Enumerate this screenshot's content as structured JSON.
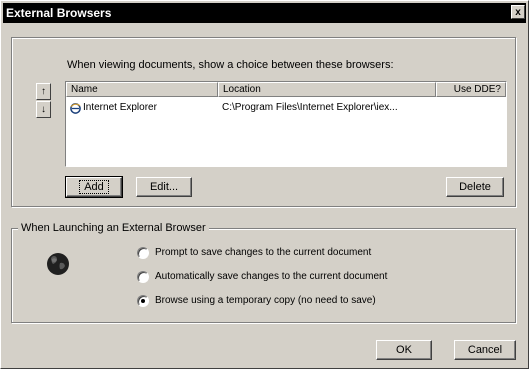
{
  "window": {
    "title": "External Browsers",
    "close_glyph": "x"
  },
  "browsers_group": {
    "instruction": "When viewing documents, show a choice between these browsers:",
    "move_up_glyph": "↑",
    "move_down_glyph": "↓",
    "columns": [
      "Name",
      "Location",
      "Use DDE?"
    ],
    "rows": [
      {
        "name": "Internet Explorer",
        "location": "C:\\Program Files\\Internet Explorer\\iex...",
        "use_dde": "",
        "icon": "internet-explorer-icon"
      }
    ],
    "add_label": "Add",
    "edit_label": "Edit...",
    "delete_label": "Delete"
  },
  "launch_group": {
    "legend": "When Launching an External Browser",
    "icon": "globe-icon",
    "options": [
      {
        "label": "Prompt to save changes to the current document",
        "checked": false
      },
      {
        "label": "Automatically save changes to the current document",
        "checked": false
      },
      {
        "label": "Browse using a temporary copy (no need to save)",
        "checked": true
      }
    ]
  },
  "footer": {
    "ok_label": "OK",
    "cancel_label": "Cancel"
  }
}
